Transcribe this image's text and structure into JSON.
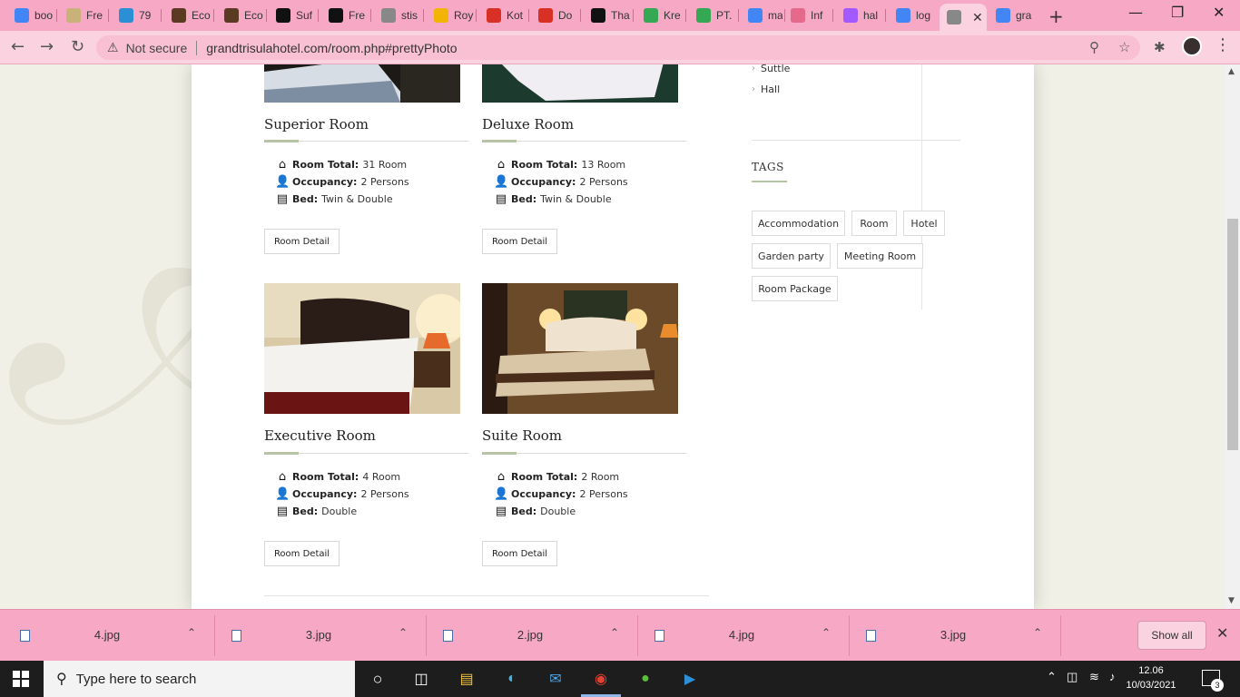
{
  "browser": {
    "tabs": [
      {
        "label": "boo",
        "favicon": "google-icon",
        "color": "#4285f4"
      },
      {
        "label": "Fre",
        "favicon": "mail-icon",
        "color": "#c8b27a"
      },
      {
        "label": "79",
        "favicon": "f-icon",
        "color": "#2b8fd6"
      },
      {
        "label": "Eco",
        "favicon": "book-icon",
        "color": "#5a3b22"
      },
      {
        "label": "Eco",
        "favicon": "book-icon",
        "color": "#5a3b22"
      },
      {
        "label": "Suf",
        "favicon": "studocu-icon",
        "color": "#111111"
      },
      {
        "label": "Fre",
        "favicon": "studocu-icon",
        "color": "#111111"
      },
      {
        "label": "stis",
        "favicon": "globe-icon",
        "color": "#888888"
      },
      {
        "label": "Roy",
        "favicon": "crown-icon",
        "color": "#f2b400"
      },
      {
        "label": "Kot",
        "favicon": "gmail-icon",
        "color": "#d93025"
      },
      {
        "label": "Do",
        "favicon": "gmail-icon",
        "color": "#d93025"
      },
      {
        "label": "Tha",
        "favicon": "studocu-icon",
        "color": "#111111"
      },
      {
        "label": "Kre",
        "favicon": "maps-icon",
        "color": "#34a853"
      },
      {
        "label": "PT.",
        "favicon": "maps-icon",
        "color": "#34a853"
      },
      {
        "label": "ma",
        "favicon": "google-icon",
        "color": "#4285f4"
      },
      {
        "label": "Inf",
        "favicon": "flower-icon",
        "color": "#e5698a"
      },
      {
        "label": "hal",
        "favicon": "figma-icon",
        "color": "#a259ff"
      },
      {
        "label": "log",
        "favicon": "google-icon",
        "color": "#4285f4"
      },
      {
        "label": "",
        "favicon": "leaf-icon",
        "color": "#888888",
        "active": true
      },
      {
        "label": "gra",
        "favicon": "google-icon",
        "color": "#4285f4"
      }
    ],
    "new_tab_label": "+",
    "address": {
      "security_label": "Not secure",
      "url": "grandtrisulahotel.com/room.php#prettyPhoto"
    }
  },
  "page": {
    "sidebar": {
      "links": [
        "Suttle",
        "Hall"
      ],
      "tags_title": "TAGS",
      "tags": [
        "Accommodation",
        "Room",
        "Hotel",
        "Garden party",
        "Meeting Room",
        "Room Package"
      ]
    },
    "rooms": [
      {
        "title": "Superior Room",
        "room_total_label": "Room Total:",
        "room_total": "31 Room",
        "occupancy_label": "Occupancy:",
        "occupancy": "2 Persons",
        "bed_label": "Bed:",
        "bed": "Twin & Double",
        "button": "Room Detail"
      },
      {
        "title": "Deluxe Room",
        "room_total_label": "Room Total:",
        "room_total": "13 Room",
        "occupancy_label": "Occupancy:",
        "occupancy": "2 Persons",
        "bed_label": "Bed:",
        "bed": "Twin & Double",
        "button": "Room Detail"
      },
      {
        "title": "Executive Room",
        "room_total_label": "Room Total:",
        "room_total": "4 Room",
        "occupancy_label": "Occupancy:",
        "occupancy": "2 Persons",
        "bed_label": "Bed:",
        "bed": "Double",
        "button": "Room Detail"
      },
      {
        "title": "Suite Room",
        "room_total_label": "Room Total:",
        "room_total": "2 Room",
        "occupancy_label": "Occupancy:",
        "occupancy": "2 Persons",
        "bed_label": "Bed:",
        "bed": "Double",
        "button": "Room Detail"
      }
    ]
  },
  "downloads": {
    "items": [
      "4.jpg",
      "3.jpg",
      "2.jpg",
      "4.jpg",
      "3.jpg"
    ],
    "show_all": "Show all"
  },
  "taskbar": {
    "search_placeholder": "Type here to search",
    "time": "12.06",
    "date": "10/03/2021",
    "notification_count": "3"
  },
  "colors": {
    "browser_frame": "#f7a8c4",
    "accent_green": "#b7c4a6",
    "page_bg": "#f1f0e6"
  }
}
